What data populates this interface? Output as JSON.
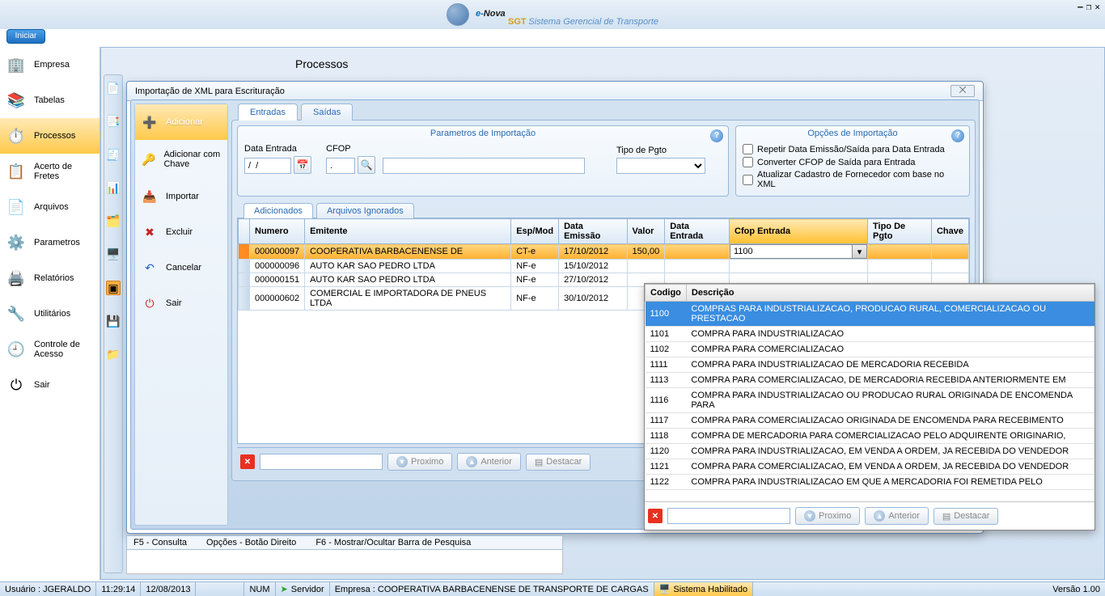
{
  "brand": {
    "e": "e-",
    "nova": "Nova",
    "sub": "SGT",
    "subtitle": "Sistema Gerencial de Transporte"
  },
  "start_button": "Iniciar",
  "main_title": "Processos",
  "sidebar": {
    "items": [
      {
        "label": "Empresa",
        "icon": "🏢"
      },
      {
        "label": "Tabelas",
        "icon": "📚"
      },
      {
        "label": "Processos",
        "icon": "⏱️"
      },
      {
        "label": "Acerto de Fretes",
        "icon": "📋"
      },
      {
        "label": "Arquivos",
        "icon": "📄"
      },
      {
        "label": "Parametros",
        "icon": "⚙️"
      },
      {
        "label": "Relatórios",
        "icon": "🖨️"
      },
      {
        "label": "Utilitários",
        "icon": "🔧"
      },
      {
        "label": "Controle de Acesso",
        "icon": "🕘"
      },
      {
        "label": "Sair",
        "icon": "⏻"
      }
    ],
    "active_index": 2
  },
  "dialog": {
    "title": "Importação de XML para Escrituração",
    "actions": [
      {
        "label": "Adicionar",
        "icon": "➕"
      },
      {
        "label": "Adicionar com Chave",
        "icon": "🔑"
      },
      {
        "label": "Importar",
        "icon": "📥"
      },
      {
        "label": "Excluir",
        "icon": "✖"
      },
      {
        "label": "Cancelar",
        "icon": "↶"
      },
      {
        "label": "Sair",
        "icon": "⏻"
      }
    ],
    "action_active_index": 0,
    "tabs": [
      "Entradas",
      "Saídas"
    ],
    "tab_active": 0,
    "params": {
      "legend": "Parametros de Importação",
      "data_entrada_label": "Data Entrada",
      "data_entrada_value": "/  /",
      "cfop_label": "CFOP",
      "cfop_value": ".",
      "desc_value": "",
      "tipo_pgto_label": "Tipo de Pgto",
      "tipo_pgto_value": ""
    },
    "options": {
      "legend": "Opções de Importação",
      "o1": "Repetir Data Emissão/Saída para Data Entrada",
      "o2": "Converter CFOP de Saída para Entrada",
      "o3": "Atualizar Cadastro de Fornecedor com base no XML"
    },
    "subtabs": [
      "Adicionados",
      "Arquivos Ignorados"
    ],
    "subtab_active": 0,
    "grid": {
      "columns": [
        "",
        "Numero",
        "Emitente",
        "Esp/Mod",
        "Data Emissão",
        "Valor",
        "Data Entrada",
        "Cfop Entrada",
        "Tipo De Pgto",
        "Chave"
      ],
      "sort_col": "Cfop Entrada",
      "rows": [
        {
          "numero": "000000097",
          "emitente": "COOPERATIVA BARBACENENSE DE",
          "esp": "CT-e",
          "emissao": "17/10/2012",
          "valor": "150,00",
          "entrada": "",
          "cfop": "1100",
          "tipo": "",
          "chave": "",
          "selected": true
        },
        {
          "numero": "000000096",
          "emitente": "AUTO KAR SAO PEDRO LTDA",
          "esp": "NF-e",
          "emissao": "15/10/2012",
          "valor": "",
          "entrada": "",
          "cfop": "",
          "tipo": "",
          "chave": ""
        },
        {
          "numero": "000000151",
          "emitente": "AUTO KAR SAO PEDRO LTDA",
          "esp": "NF-e",
          "emissao": "27/10/2012",
          "valor": "",
          "entrada": "",
          "cfop": "",
          "tipo": "",
          "chave": ""
        },
        {
          "numero": "000000602",
          "emitente": "COMERCIAL E IMPORTADORA DE PNEUS LTDA",
          "esp": "NF-e",
          "emissao": "30/10/2012",
          "valor": "",
          "entrada": "",
          "cfop": "",
          "tipo": "",
          "chave": ""
        }
      ]
    },
    "search": {
      "proximo": "Proximo",
      "anterior": "Anterior",
      "destacar": "Destacar"
    },
    "statusbar": {
      "f5": "F5 - Consulta",
      "opcoes": "Opções - Botão Direito",
      "f6": "F6 - Mostrar/Ocultar Barra de Pesquisa"
    }
  },
  "cfop_popup": {
    "columns": [
      "Codigo",
      "Descrição"
    ],
    "hl_index": 0,
    "rows": [
      {
        "codigo": "1100",
        "desc": "COMPRAS PARA INDUSTRIALIZACAO, PRODUCAO RURAL, COMERCIALIZACAO OU PRESTACAO"
      },
      {
        "codigo": "1101",
        "desc": "COMPRA PARA INDUSTRIALIZACAO"
      },
      {
        "codigo": "1102",
        "desc": "COMPRA PARA COMERCIALIZACAO"
      },
      {
        "codigo": "1111",
        "desc": "COMPRA PARA INDUSTRIALIZACAO DE MERCADORIA RECEBIDA"
      },
      {
        "codigo": "1113",
        "desc": "COMPRA PARA COMERCIALIZACAO, DE MERCADORIA RECEBIDA ANTERIORMENTE EM"
      },
      {
        "codigo": "1116",
        "desc": "COMPRA PARA INDUSTRIALIZACAO OU PRODUCAO RURAL ORIGINADA DE ENCOMENDA PARA"
      },
      {
        "codigo": "1117",
        "desc": "COMPRA PARA COMERCIALIZACAO ORIGINADA DE ENCOMENDA PARA RECEBIMENTO"
      },
      {
        "codigo": "1118",
        "desc": "COMPRA DE MERCADORIA PARA COMERCIALIZACAO PELO ADQUIRENTE ORIGINARIO,"
      },
      {
        "codigo": "1120",
        "desc": "COMPRA PARA INDUSTRIALIZACAO, EM VENDA A ORDEM, JA RECEBIDA DO VENDEDOR"
      },
      {
        "codigo": "1121",
        "desc": "COMPRA PARA COMERCIALIZACAO, EM VENDA A ORDEM, JA RECEBIDA DO VENDEDOR"
      },
      {
        "codigo": "1122",
        "desc": "COMPRA PARA INDUSTRIALIZACAO EM QUE A MERCADORIA FOI REMETIDA PELO"
      }
    ],
    "search": {
      "proximo": "Proximo",
      "anterior": "Anterior",
      "destacar": "Destacar"
    }
  },
  "app_status": {
    "user": "Usuário : JGERALDO",
    "time": "11:29:14",
    "date": "12/08/2013",
    "num": "NUM",
    "servidor": "Servidor",
    "empresa": "Empresa : COOPERATIVA BARBACENENSE DE TRANSPORTE DE CARGAS",
    "sistema": "Sistema Habilitado",
    "versao": "Versão 1.00"
  }
}
